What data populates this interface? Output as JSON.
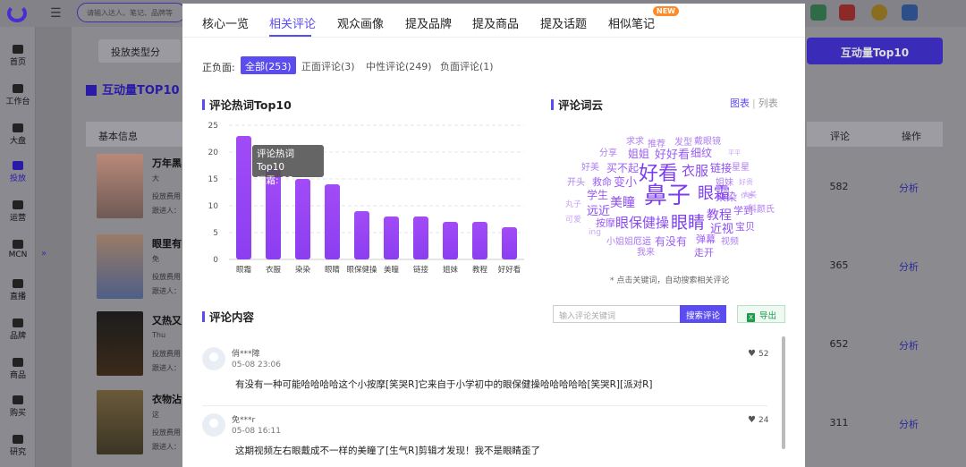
{
  "bg": {
    "search_placeholder": "请输入达人、笔记、品牌等",
    "nav": [
      {
        "label": "首页"
      },
      {
        "label": "工作台"
      },
      {
        "label": "大盘"
      },
      {
        "label": "投放"
      },
      {
        "label": "运营"
      },
      {
        "label": "MCN"
      },
      {
        "label": "直播"
      },
      {
        "label": "品牌"
      },
      {
        "label": "商品"
      },
      {
        "label": "购买"
      },
      {
        "label": "研究"
      }
    ],
    "btn_type": "投放类型分",
    "section_title": "互动量TOP10",
    "top_right_btn": "互动量Top10",
    "th_basic": "基本信息",
    "th_comment": "评论",
    "th_action": "操作",
    "rows": [
      {
        "title": "万年黑",
        "sub1": "大",
        "sub2": "投放费用",
        "sub3": "跟进人：",
        "comments": "582",
        "action": "分析"
      },
      {
        "title": "眼里有",
        "sub1": "免",
        "sub2": "投放费用",
        "sub3": "跟进人：",
        "comments": "365",
        "action": "分析"
      },
      {
        "title": "又热又",
        "sub1": "Thu",
        "sub2": "投放费用",
        "sub3": "跟进人：",
        "comments": "652",
        "action": "分析"
      },
      {
        "title": "衣物沾",
        "sub1": "这",
        "sub2": "投放费用",
        "sub3": "跟进人：",
        "comments": "311",
        "action": "分析"
      }
    ],
    "colors": {
      "brand": "#3a2bb8"
    }
  },
  "modal": {
    "tabs": [
      {
        "label": "核心一览"
      },
      {
        "label": "相关评论"
      },
      {
        "label": "观众画像"
      },
      {
        "label": "提及品牌"
      },
      {
        "label": "提及商品"
      },
      {
        "label": "提及话题"
      },
      {
        "label": "相似笔记"
      }
    ],
    "new_badge": "NEW",
    "filter": {
      "label": "正负面:",
      "options": [
        {
          "label": "全部(253)"
        },
        {
          "label": "正面评论(3)"
        },
        {
          "label": "中性评论(249)"
        },
        {
          "label": "负面评论(1)"
        }
      ]
    },
    "hot_title": "评论热词Top10",
    "cloud_title": "评论词云",
    "view_chart": "图表",
    "view_sep": "|",
    "view_list": "列表",
    "cloud_note": "* 点击关键词，自动搜索相关评论",
    "cloud_words": [
      "求求",
      "推荐",
      "发型",
      "戴眼镜",
      "分享",
      "姐姐",
      "好好看",
      "细纹",
      "好美",
      "买不起",
      "好看",
      "衣服",
      "链接",
      "星星",
      "开头",
      "救命",
      "变小",
      "姐妹",
      "学生",
      "鼻子",
      "眼霜",
      "染染",
      "好贵",
      "美瞳",
      "大美",
      "丸子",
      "远近",
      "教程",
      "学到",
      "科颜氏",
      "可爱",
      "按摩",
      "眼保健操",
      "眼睛",
      "近视",
      "宝贝",
      "ing",
      "小姐姐",
      "厄运",
      "有没有",
      "弹幕",
      "视频",
      "我来",
      "走开",
      "平平",
      "作者"
    ],
    "tooltip_title": "评论热词Top10",
    "tooltip_value": "眼霜: 23",
    "content_title": "评论内容",
    "kw_placeholder": "输入评论关键词",
    "kw_button": "搜索评论",
    "export_icon": "X",
    "export_button": "导出",
    "comments": [
      {
        "user": "俏***障",
        "time": "05-08 23:06",
        "likes": "52",
        "text": "有没有一种可能哈哈哈哈这个小按摩[笑哭R]它来自于小学初中的眼保健操哈哈哈哈哈[笑哭R][派对R]"
      },
      {
        "user": "免***r",
        "time": "05-08 16:11",
        "likes": "24",
        "text": "这期视频左右眼戴成不一样的美瞳了[生气R]剪辑才发现！我不是眼睛歪了"
      }
    ]
  },
  "chart_data": {
    "type": "bar",
    "title": "评论热词Top10",
    "categories": [
      "眼霜",
      "衣服",
      "染染",
      "眼睛",
      "眼保健操",
      "美瞳",
      "链接",
      "姐妹",
      "教程",
      "好好看"
    ],
    "values": [
      23,
      17,
      15,
      14,
      9,
      8,
      8,
      7,
      7,
      6
    ],
    "yticks": [
      0,
      5,
      10,
      15,
      20,
      25
    ],
    "ylim": [
      0,
      25
    ],
    "grid": true,
    "bar_color_top": "#a24bf7",
    "bar_color_bottom": "#8b3ef0"
  }
}
